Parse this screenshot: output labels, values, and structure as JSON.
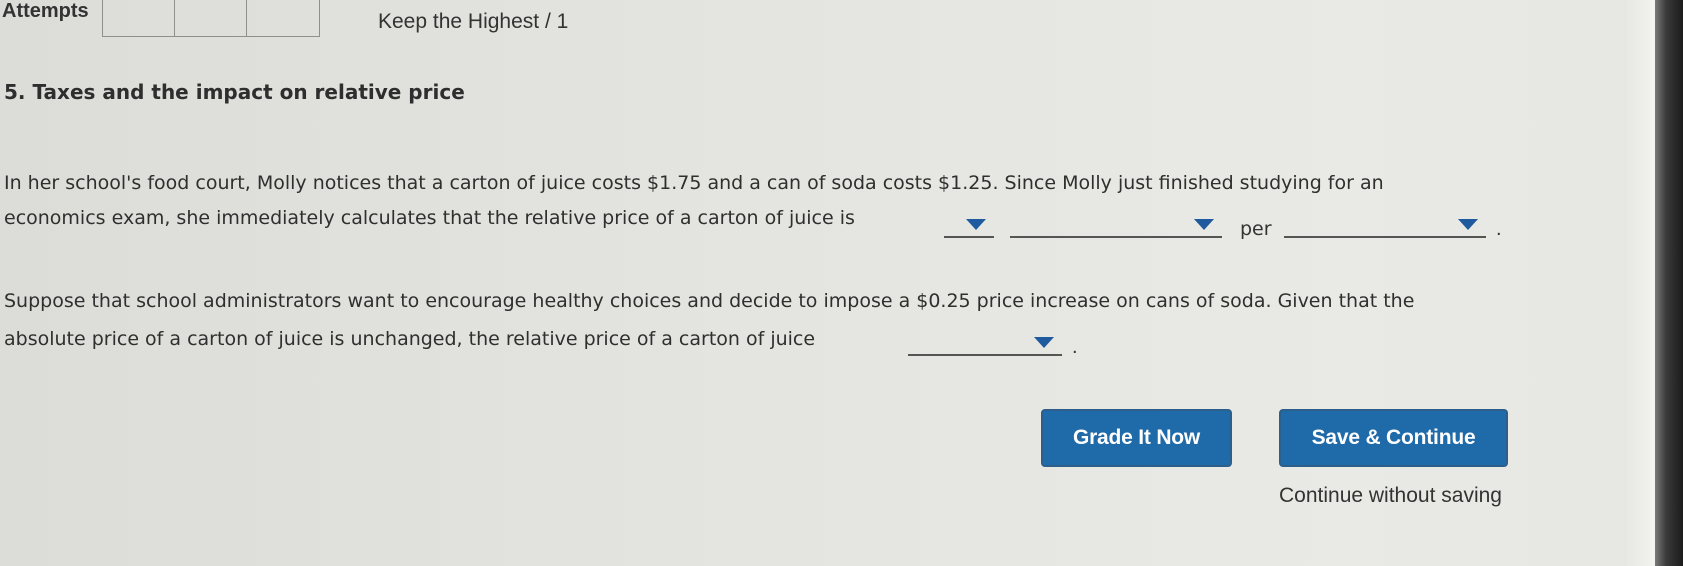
{
  "header": {
    "attempts_label": "Attempts",
    "attempt_boxes": [
      "",
      "",
      ""
    ],
    "keep_highest": "Keep the Highest / 1"
  },
  "question": {
    "title": "5. Taxes and the impact on relative price",
    "para1_line1": "In her school's food court, Molly notices that a carton of juice costs $1.75 and a can of soda costs $1.25. Since Molly just finished studying for an",
    "para1_line2": "economics exam, she immediately calculates that the relative price of a carton of juice is",
    "per_label": "per",
    "period": ".",
    "dropdowns": {
      "relative_price_value": "",
      "relative_price_unit": "",
      "per_unit": "",
      "relative_price_change": ""
    },
    "para2_line1": "Suppose that school administrators want to encourage healthy choices and decide to impose a $0.25 price increase on cans of soda. Given that the",
    "para2_line2": "absolute price of a carton of juice is unchanged, the relative price of a carton of juice"
  },
  "actions": {
    "grade_label": "Grade It Now",
    "save_label": "Save & Continue",
    "continue_without_saving": "Continue without saving"
  },
  "colors": {
    "button_bg": "#1f6aa8",
    "dropdown_arrow": "#1f5a9e"
  }
}
